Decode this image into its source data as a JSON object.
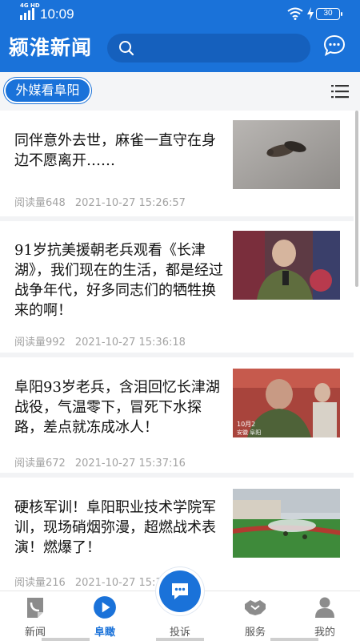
{
  "status_bar": {
    "network": "4G HD",
    "time": "10:09",
    "battery": "30"
  },
  "header": {
    "title": "颍淮新闻",
    "search_placeholder": ""
  },
  "channel": {
    "active_label": "外媒看阜阳"
  },
  "news": [
    {
      "title": "同伴意外去世，麻雀一直守在身边不愿离开……",
      "reads": "阅读量648",
      "datetime": "2021-10-27  15:26:57",
      "thumb": "sparrows-on-pavement"
    },
    {
      "title": " 91岁抗美援朝老兵观看《长津湖》，我们现在的生活，都是经过战争年代，好多同志们的牺牲换来的啊！",
      "reads": "阅读量992",
      "datetime": "2021-10-27  15:36:18",
      "thumb": "veteran-with-microphone"
    },
    {
      "title": "阜阳93岁老兵，含泪回忆长津湖战役，气温零下，冒死下水探路，差点就冻成冰人！",
      "reads": "阅读量672",
      "datetime": "2021-10-27  15:37:16",
      "thumb": "veteran-in-theater"
    },
    {
      "title": "硬核军训！阜阳职业技术学院军训，现场硝烟弥漫，超燃战术表演！燃爆了！",
      "reads": "阅读量216",
      "datetime": "2021-10-27  15:35:46",
      "thumb": "military-training-field"
    }
  ],
  "thumb_overlay": {
    "line1": "10月2",
    "line2": "安徽 阜阳"
  },
  "tabbar": {
    "tabs": [
      {
        "label": "新闻",
        "icon": "newspaper-icon"
      },
      {
        "label": "阜瞰",
        "icon": "play-icon"
      },
      {
        "label": "投诉",
        "icon": "chat-bubble-icon"
      },
      {
        "label": "服务",
        "icon": "handshake-icon"
      },
      {
        "label": "我的",
        "icon": "person-icon"
      }
    ],
    "active_index": 1
  },
  "colors": {
    "brand": "#1a72d9",
    "meta_text": "#a3a3a3"
  }
}
